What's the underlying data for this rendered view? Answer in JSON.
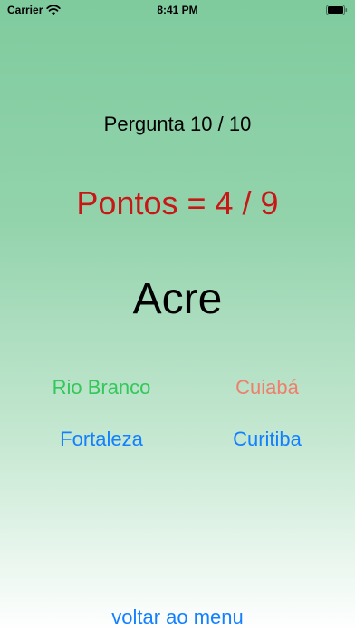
{
  "status_bar": {
    "carrier": "Carrier",
    "time": "8:41 PM",
    "wifi_icon": "wifi-icon",
    "battery_icon": "battery-icon"
  },
  "quiz": {
    "question_counter": "Pergunta 10 / 10",
    "score": "Pontos = 4 / 9",
    "state_name": "Acre",
    "options": [
      {
        "label": "Rio Branco",
        "color": "#34c759"
      },
      {
        "label": "Cuiabá",
        "color": "#ee7f6c"
      },
      {
        "label": "Fortaleza",
        "color": "#1380ff"
      },
      {
        "label": "Curitiba",
        "color": "#1380ff"
      }
    ],
    "back_label": "voltar ao menu"
  },
  "colors": {
    "score": "#c81717",
    "link": "#1380ff",
    "correct": "#34c759",
    "wrong": "#ee7f6c"
  }
}
